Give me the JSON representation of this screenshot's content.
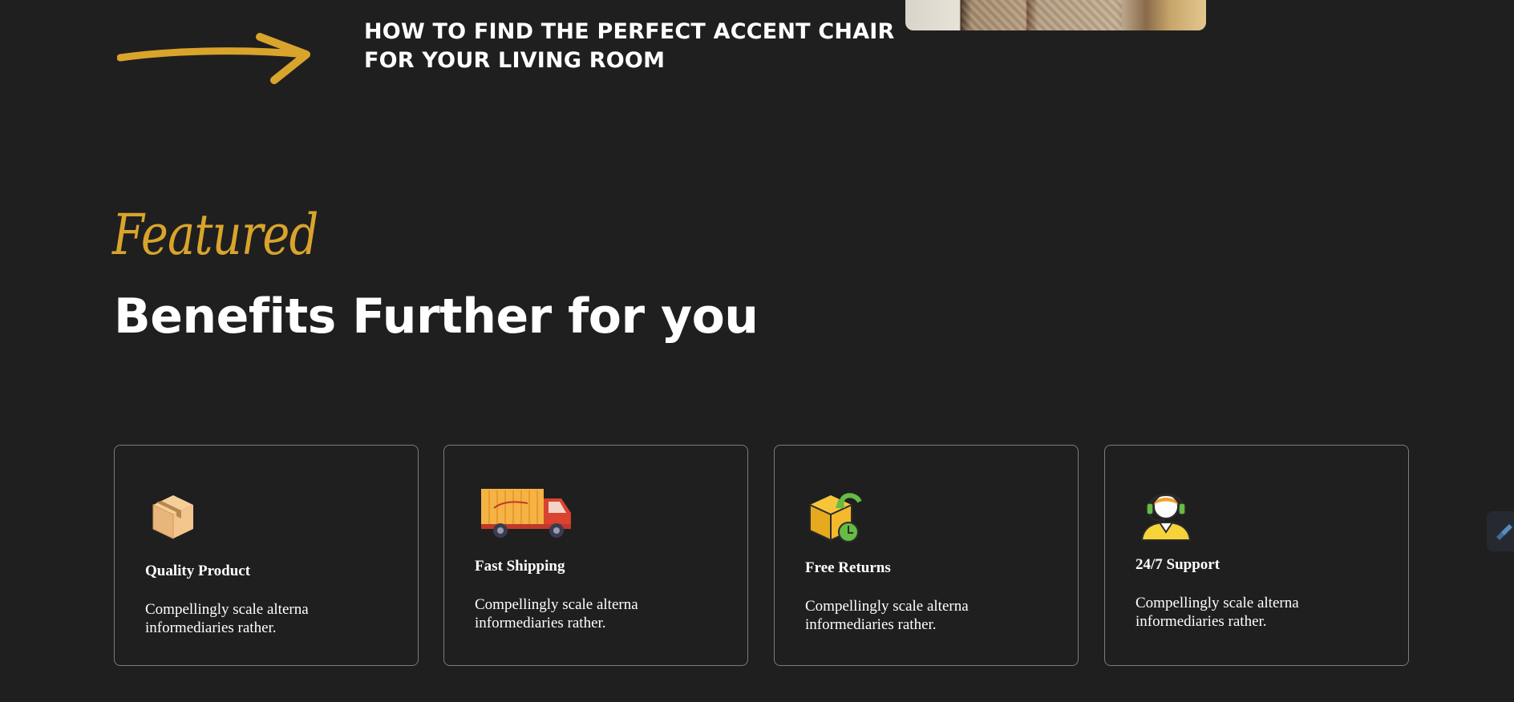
{
  "article": {
    "title_line1": "HOW TO FIND THE PERFECT ACCENT CHAIR",
    "title_line2": "FOR YOUR LIVING ROOM",
    "arrow_icon": "arrow-right-icon"
  },
  "section": {
    "eyebrow": "Featured",
    "heading": "Benefits Further for you"
  },
  "colors": {
    "background": "#1f1f1f",
    "accent": "#d9a42c",
    "text": "#ffffff",
    "card_border": "#7b7b7b"
  },
  "cards": [
    {
      "icon": "box-icon",
      "title": "Quality Product",
      "desc_line1": "Compellingly scale alterna",
      "desc_line2": "informediaries rather."
    },
    {
      "icon": "delivery-truck-icon",
      "title": "Fast Shipping",
      "desc_line1": "Compellingly scale alterna",
      "desc_line2": "informediaries rather."
    },
    {
      "icon": "return-box-icon",
      "title": "Free Returns",
      "desc_line1": "Compellingly scale alterna",
      "desc_line2": "informediaries rather."
    },
    {
      "icon": "support-agent-icon",
      "title": "24/7 Support",
      "desc_line1": "Compellingly scale alterna",
      "desc_line2": "informediaries rather."
    }
  ]
}
